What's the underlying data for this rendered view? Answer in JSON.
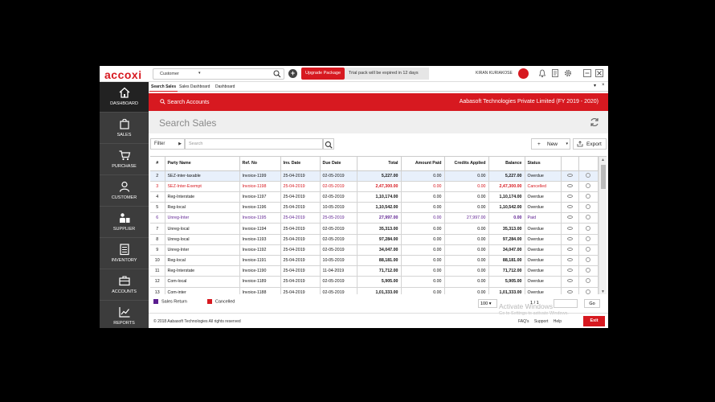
{
  "app": {
    "logo": "accoxi",
    "search_scope": "Customer",
    "upgrade_label": "Upgrade Package",
    "trial_text": "Trial pack will be expired in 12 days",
    "user_name": "KIRAN KURIAKOSE"
  },
  "sidebar": {
    "items": [
      {
        "label": "DASHBOARD",
        "icon": "home-icon"
      },
      {
        "label": "SALES",
        "icon": "shopping-bag-icon"
      },
      {
        "label": "PURCHASE",
        "icon": "cart-icon"
      },
      {
        "label": "CUSTOMER",
        "icon": "user-icon"
      },
      {
        "label": "SUPPLIER",
        "icon": "supplier-icon"
      },
      {
        "label": "INVENTORY",
        "icon": "inventory-icon"
      },
      {
        "label": "ACCOUNTS",
        "icon": "briefcase-icon"
      },
      {
        "label": "REPORTS",
        "icon": "chart-icon"
      }
    ]
  },
  "tabs": [
    "Search Sales",
    "Sales Dashboard",
    "Dashboard"
  ],
  "header": {
    "breadcrumb": "Search Accounts",
    "company": "Aabasoft Technologies Private Limited (FY 2019 - 2020)",
    "title": "Search Sales"
  },
  "toolbar": {
    "filter_label": "Filter",
    "search_placeholder": "Search",
    "new_label": "New",
    "export_label": "Export"
  },
  "table": {
    "columns": [
      "#",
      "Party Name",
      "Ref. No",
      "Inv. Date",
      "Due Date",
      "Total",
      "Amount Paid",
      "Credits Applied",
      "Balance",
      "Status"
    ],
    "rows": [
      {
        "n": "2",
        "party": "SEZ-inter-taxable",
        "ref": "Invoice-1199",
        "inv": "25-04-2019",
        "due": "02-05-2019",
        "total": "5,227.00",
        "paid": "0.00",
        "credits": "0.00",
        "balance": "5,227.00",
        "status": "Overdue",
        "style": "hl"
      },
      {
        "n": "3",
        "party": "SEZ-Inter-Exempt",
        "ref": "Invoice-1198",
        "inv": "25-04-2019",
        "due": "02-05-2019",
        "total": "2,47,300.00",
        "paid": "0.00",
        "credits": "0.00",
        "balance": "2,47,300.00",
        "status": "Cancelled",
        "style": "red"
      },
      {
        "n": "4",
        "party": "Reg-Interstate",
        "ref": "Invoice-1197",
        "inv": "25-04-2019",
        "due": "02-05-2019",
        "total": "1,10,174.00",
        "paid": "0.00",
        "credits": "0.00",
        "balance": "1,10,174.00",
        "status": "Overdue",
        "style": ""
      },
      {
        "n": "5",
        "party": "Reg-local",
        "ref": "Invoice-1196",
        "inv": "25-04-2019",
        "due": "10-05-2019",
        "total": "1,10,542.00",
        "paid": "0.00",
        "credits": "0.00",
        "balance": "1,10,542.00",
        "status": "Overdue",
        "style": ""
      },
      {
        "n": "6",
        "party": "Unreg-Inter",
        "ref": "Invoice-1195",
        "inv": "25-04-2019",
        "due": "25-05-2019",
        "total": "27,997.00",
        "paid": "0.00",
        "credits": "27,997.00",
        "balance": "0.00",
        "status": "Paid",
        "style": "purple"
      },
      {
        "n": "7",
        "party": "Unreg-local",
        "ref": "Invoice-1194",
        "inv": "25-04-2019",
        "due": "02-05-2019",
        "total": "35,313.00",
        "paid": "0.00",
        "credits": "0.00",
        "balance": "35,313.00",
        "status": "Overdue",
        "style": ""
      },
      {
        "n": "8",
        "party": "Unreg-local",
        "ref": "Invoice-1193",
        "inv": "25-04-2019",
        "due": "02-05-2019",
        "total": "97,284.00",
        "paid": "0.00",
        "credits": "0.00",
        "balance": "97,284.00",
        "status": "Overdue",
        "style": ""
      },
      {
        "n": "9",
        "party": "Unreg-Inter",
        "ref": "Invoice-1192",
        "inv": "25-04-2019",
        "due": "02-05-2019",
        "total": "34,047.00",
        "paid": "0.00",
        "credits": "0.00",
        "balance": "34,047.00",
        "status": "Overdue",
        "style": ""
      },
      {
        "n": "10",
        "party": "Reg-local",
        "ref": "Invoice-1191",
        "inv": "25-04-2019",
        "due": "10-05-2019",
        "total": "88,181.00",
        "paid": "0.00",
        "credits": "0.00",
        "balance": "88,181.00",
        "status": "Overdue",
        "style": ""
      },
      {
        "n": "11",
        "party": "Reg-Interstate",
        "ref": "Invoice-1190",
        "inv": "25-04-2019",
        "due": "11-04-2019",
        "total": "71,712.00",
        "paid": "0.00",
        "credits": "0.00",
        "balance": "71,712.00",
        "status": "Overdue",
        "style": ""
      },
      {
        "n": "12",
        "party": "Com-local",
        "ref": "Invoice-1189",
        "inv": "25-04-2019",
        "due": "02-05-2019",
        "total": "5,905.00",
        "paid": "0.00",
        "credits": "0.00",
        "balance": "5,905.00",
        "status": "Overdue",
        "style": ""
      },
      {
        "n": "13",
        "party": "Com-inter",
        "ref": "Invoice-1188",
        "inv": "25-04-2019",
        "due": "02-05-2019",
        "total": "1,01,333.00",
        "paid": "0.00",
        "credits": "0.00",
        "balance": "1,01,333.00",
        "status": "Overdue",
        "style": ""
      }
    ]
  },
  "legend": {
    "sales_return": "Sales Return",
    "cancelled": "Cancelled",
    "sales_return_color": "#5b1d8f",
    "cancelled_color": "#d71920"
  },
  "pager": {
    "page_size": "100",
    "pages": "1 / 1",
    "go_label": "Go"
  },
  "watermark": {
    "line1": "Activate Windows",
    "line2": "Go to Settings to activate Windows."
  },
  "footer": {
    "copyright": "© 2018 Aabasoft Technologies All rights reserved",
    "links": [
      "FAQ's",
      "Support",
      "Help"
    ],
    "exit_label": "Exit"
  }
}
